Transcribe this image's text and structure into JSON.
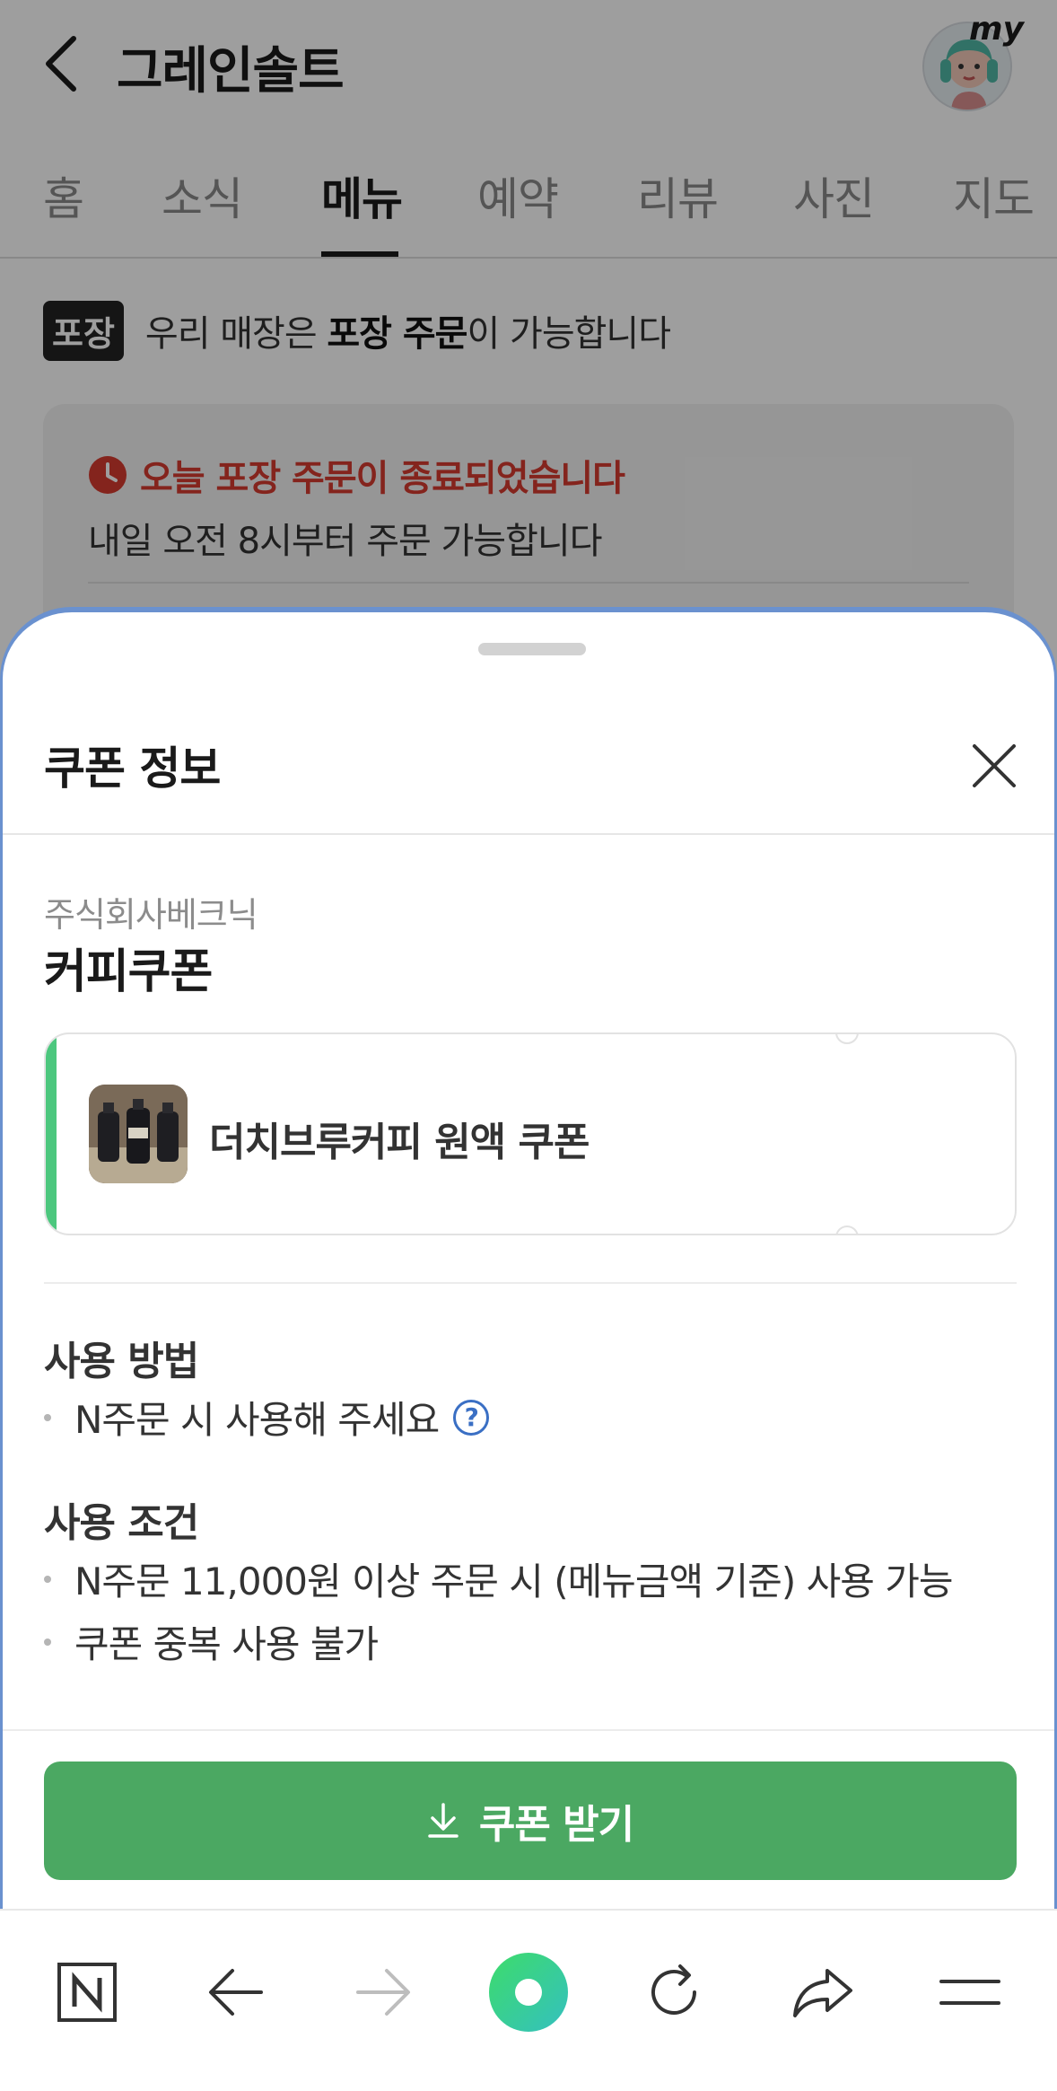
{
  "header": {
    "title": "그레인솔트",
    "avatar_badge": "my"
  },
  "tabs": [
    {
      "label": "홈",
      "active": false
    },
    {
      "label": "소식",
      "active": false
    },
    {
      "label": "메뉴",
      "active": true
    },
    {
      "label": "예약",
      "active": false
    },
    {
      "label": "리뷰",
      "active": false
    },
    {
      "label": "사진",
      "active": false
    },
    {
      "label": "지도",
      "active": false
    }
  ],
  "takeout": {
    "badge": "포장",
    "text_before": "우리 매장은 ",
    "text_bold": "포장 주문",
    "text_after": "이 가능합니다"
  },
  "notice": {
    "title": "오늘 포장 주문이 종료되었습니다",
    "subtitle": "내일 오전 8시부터 주문 가능합니다"
  },
  "sheet": {
    "title": "쿠폰 정보",
    "issuer": "주식회사베크닉",
    "coupon_name": "커피쿠폰",
    "ticket_label": "더치브루커피 원액 쿠폰",
    "usage_title": "사용 방법",
    "usage_items": [
      "N주문 시 사용해 주세요"
    ],
    "conditions_title": "사용 조건",
    "condition_items": [
      "N주문 11,000원 이상 주문 시 (메뉴금액 기준) 사용 가능",
      "쿠폰 중복 사용 불가"
    ],
    "cta_label": "쿠폰 받기"
  },
  "colors": {
    "accent_green": "#4ba862",
    "ticket_accent": "#4cc77e",
    "notice_red": "#d63a2f",
    "link_blue": "#3a6fc4"
  },
  "toolbar": {
    "items": [
      "naver-home-icon",
      "back-arrow-icon",
      "forward-arrow-icon",
      "green-dot-icon",
      "refresh-icon",
      "share-icon",
      "menu-icon"
    ]
  }
}
